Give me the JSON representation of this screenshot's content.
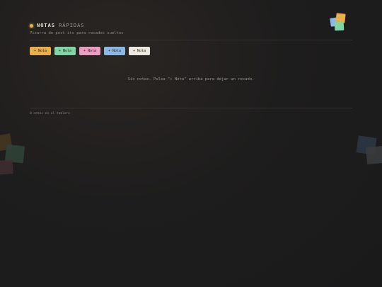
{
  "header": {
    "title_strong": "NOTAS",
    "title_light": "RÁPIDAS",
    "subtitle": "Pizarra de post-its para recados sueltos"
  },
  "colors": {
    "amarillo": "#e8b04a",
    "verde": "#7fd6a4",
    "rosa": "#ec9ec2",
    "azul": "#8cb8e6",
    "blanco": "#ece7df"
  },
  "toolbar": {
    "buttons": [
      {
        "label": "+ Nota",
        "color": "amarillo"
      },
      {
        "label": "+ Nota",
        "color": "verde"
      },
      {
        "label": "+ Nota",
        "color": "rosa"
      },
      {
        "label": "+ Nota",
        "color": "azul"
      },
      {
        "label": "+ Nota",
        "color": "blanco"
      }
    ]
  },
  "board": {
    "empty_message": "Sin notas. Pulsa \"+ Nota\" arriba para dejar un recado."
  },
  "footer": {
    "count_text": "0 notas en el tablero"
  },
  "icons": {
    "logo": "sticky-notes-logo-icon",
    "status": "status-dot-icon"
  }
}
